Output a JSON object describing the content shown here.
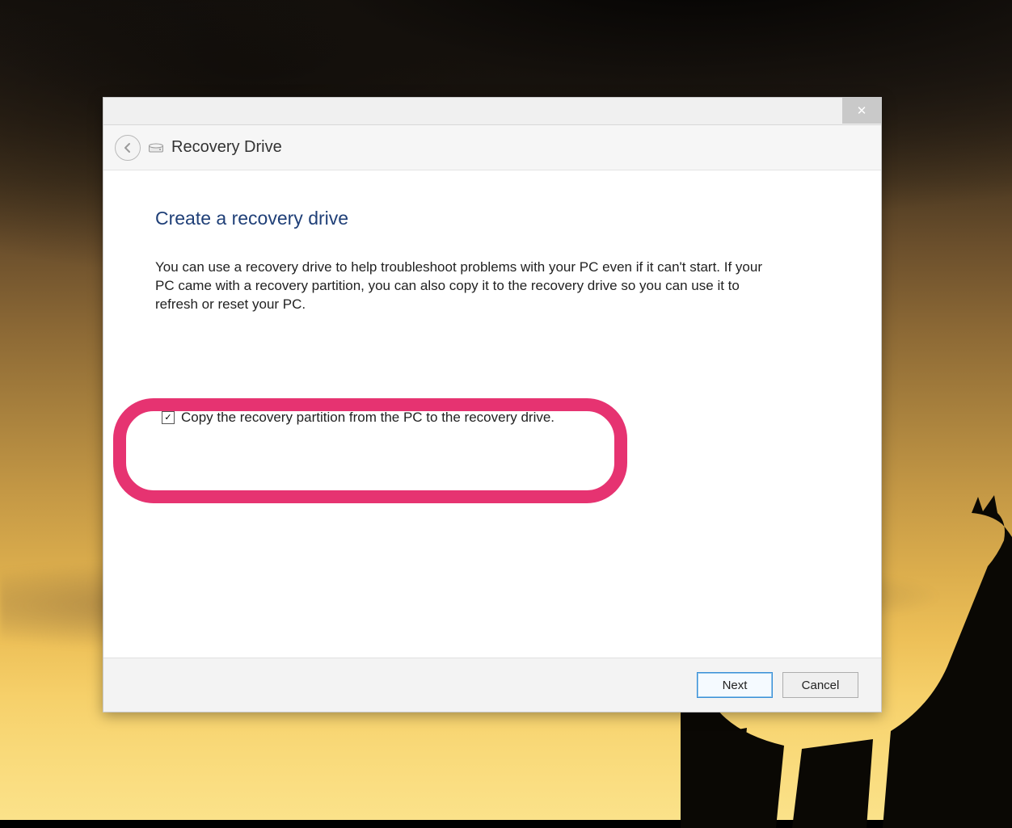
{
  "window": {
    "nav_title": "Recovery Drive"
  },
  "page": {
    "heading": "Create a recovery drive",
    "body": "You can use a recovery drive to help troubleshoot problems with your PC even if it can't start. If your PC came with a recovery partition, you can also copy it to the recovery drive so you can use it to refresh or reset your PC."
  },
  "checkbox": {
    "label": "Copy the recovery partition from the PC to the recovery drive.",
    "checked": true
  },
  "buttons": {
    "next": "Next",
    "cancel": "Cancel"
  },
  "icons": {
    "close": "✕",
    "checkmark": "✓"
  },
  "annotation": {
    "color": "#e63371"
  }
}
